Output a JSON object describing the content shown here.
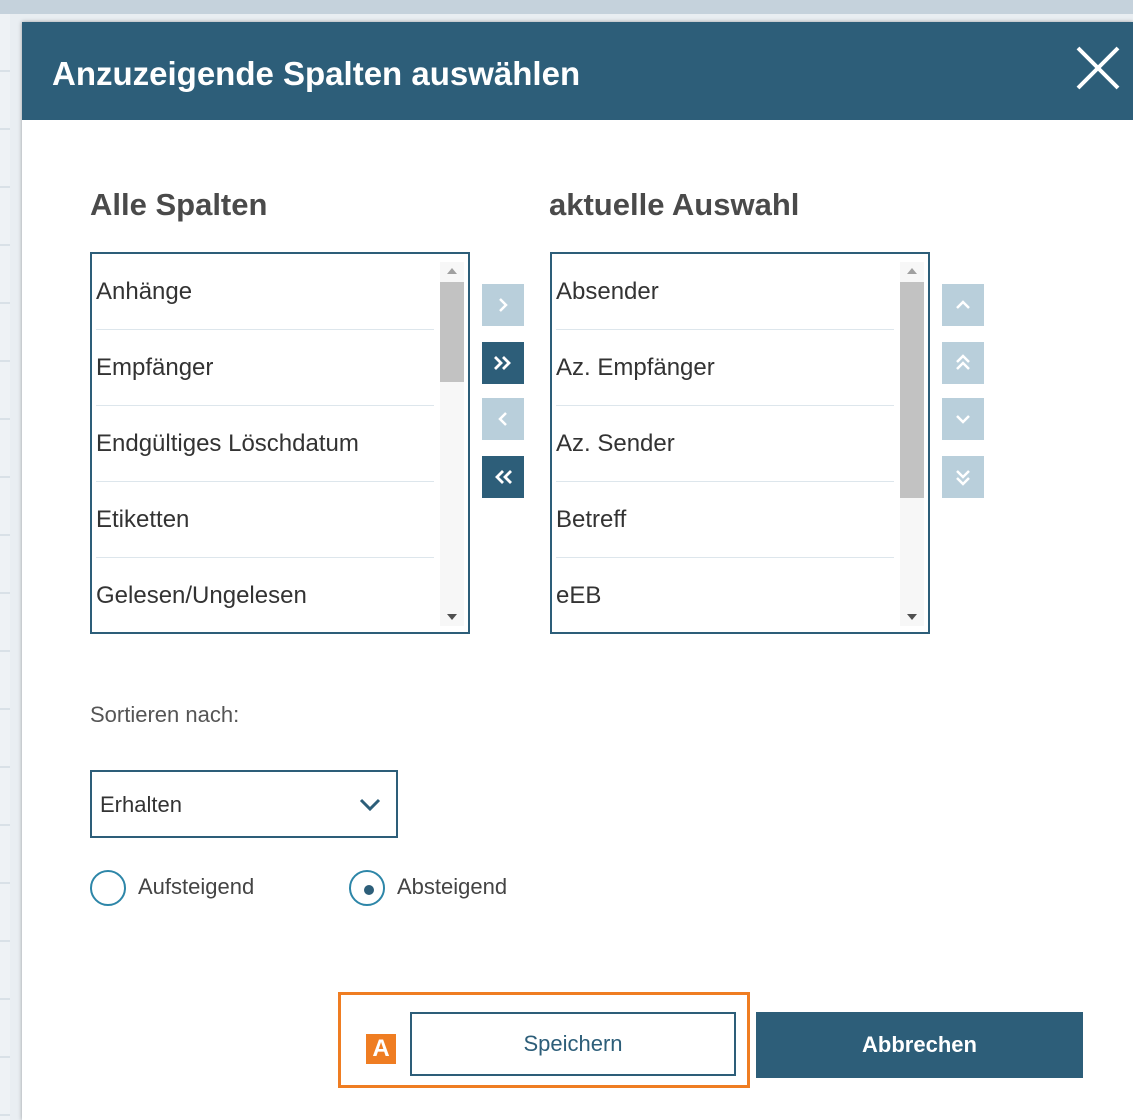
{
  "dialog": {
    "title": "Anzuzeigende Spalten auswählen"
  },
  "available": {
    "heading": "Alle Spalten",
    "items": [
      "Anhänge",
      "Empfänger",
      "Endgültiges Löschdatum",
      "Etiketten",
      "Gelesen/Ungelesen"
    ]
  },
  "selected": {
    "heading": "aktuelle Auswahl",
    "items": [
      "Absender",
      "Az. Empfänger",
      "Az. Sender",
      "Betreff",
      "eEB"
    ]
  },
  "sort": {
    "label": "Sortieren nach:",
    "selected": "Erhalten",
    "order_options": [
      {
        "label": "Aufsteigend",
        "checked": false
      },
      {
        "label": "Absteigend",
        "checked": true
      }
    ]
  },
  "annotation": {
    "marker": "A",
    "color": "#ef7d22"
  },
  "buttons": {
    "save": "Speichern",
    "cancel": "Abbrechen"
  },
  "colors": {
    "primary": "#2d5e79",
    "disabled_button": "#b9cfdb",
    "highlight": "#ef7d22"
  }
}
